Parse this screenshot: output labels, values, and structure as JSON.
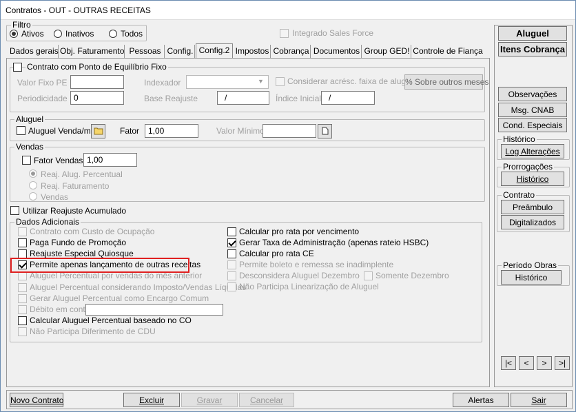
{
  "window": {
    "title": "Contratos - OUT - OUTRAS RECEITAS"
  },
  "filtro": {
    "caption": "Filtro",
    "options": [
      "Ativos",
      "Inativos",
      "Todos"
    ],
    "selected": "Ativos",
    "integrado": "Integrado Sales Force"
  },
  "tabs": [
    "Dados gerais",
    "Obj. Faturamento",
    "Pessoas",
    "Config.",
    "Config.2",
    "Impostos",
    "Cobrança",
    "Documentos",
    "Group GED!",
    "Controle de Fiança"
  ],
  "active_tab": "Config.2",
  "equilibrio": {
    "caption": "Contrato com Ponto de Equilíbrio Fixo",
    "valor_fixo_pe": "Valor Fixo PE",
    "indexador": "Indexador",
    "considerar": "Considerar acrésc. faixa de aluguel",
    "sobre_btn": "% Sobre outros meses",
    "periodicidade": "Periodicidade",
    "periodicidade_value": "0",
    "base_reajuste": "Base Reajuste",
    "base_value": "/",
    "indice_inicial": "Índice Inicial",
    "indice_value": "/"
  },
  "aluguel": {
    "caption": "Aluguel",
    "venda_m2": "Aluguel Venda/m²",
    "fator": "Fator",
    "fator_value": "1,00",
    "valor_minimo": "Valor Mínimo"
  },
  "vendas": {
    "caption": "Vendas",
    "fator_vendas": "Fator Vendas",
    "fator_value": "1,00",
    "options": [
      "Reaj. Alug. Percentual",
      "Reaj. Faturamento",
      "Vendas"
    ]
  },
  "utilizar": "Utilizar Reajuste Acumulado",
  "dados": {
    "caption": "Dados Adicionais",
    "left": [
      {
        "label": "Contrato com Custo de Ocupação",
        "checked": false,
        "enabled": false
      },
      {
        "label": "Paga Fundo de Promoção",
        "checked": false,
        "enabled": true
      },
      {
        "label": "Reajuste Especial Quiosque",
        "checked": false,
        "enabled": true
      },
      {
        "label": "Permite apenas lançamento de outras receitas",
        "checked": true,
        "enabled": true
      },
      {
        "label": "Aluguel Percentual por vendas do mês anterior",
        "checked": false,
        "enabled": false
      },
      {
        "label": "Aluguel Percentual considerando Imposto/Vendas Líquidas",
        "checked": false,
        "enabled": false
      },
      {
        "label": "Gerar Aluguel Percentual como Encargo Comum",
        "checked": false,
        "enabled": false
      },
      {
        "label": "Débito em conta",
        "checked": false,
        "enabled": false
      },
      {
        "label": "Calcular Aluguel Percentual baseado no CO",
        "checked": false,
        "enabled": true
      },
      {
        "label": "Não Participa Diferimento de CDU",
        "checked": false,
        "enabled": false
      }
    ],
    "right": [
      {
        "label": "Calcular pro rata por vencimento",
        "checked": false,
        "enabled": true
      },
      {
        "label": "Gerar Taxa de Administração (apenas rateio HSBC)",
        "checked": true,
        "enabled": true
      },
      {
        "label": "Calcular pro rata CE",
        "checked": false,
        "enabled": true
      },
      {
        "label": "Permite boleto e remessa se inadimplente",
        "checked": false,
        "enabled": false
      },
      {
        "label": "Desconsidera Aluguel Dezembro",
        "checked": false,
        "enabled": false
      },
      {
        "label": "Não Participa Linearização de Aluguel",
        "checked": false,
        "enabled": false
      }
    ],
    "somente_dezembro": "Somente Dezembro"
  },
  "side": {
    "aluguel": "Aluguel",
    "itens": "Itens Cobrança",
    "observacoes": "Observações",
    "msg_cnab": "Msg. CNAB",
    "cond": "Cond. Especiais",
    "historico_cap": "Histórico",
    "log": "Log Alterações",
    "prorrog_cap": "Prorrogações",
    "prorrog_btn": "Histórico",
    "contrato_cap": "Contrato",
    "preambulo": "Preâmbulo",
    "digitalizados": "Digitalizados",
    "periodo_cap": "Período Obras",
    "periodo_btn": "Histórico"
  },
  "nav": [
    "|<",
    "<",
    ">",
    ">|"
  ],
  "bottom": {
    "novo": "Novo Contrato",
    "excluir": "Excluir",
    "gravar": "Gravar",
    "cancelar": "Cancelar",
    "alertas": "Alertas",
    "sair": "Sair"
  },
  "highlight_color": "#e02020"
}
